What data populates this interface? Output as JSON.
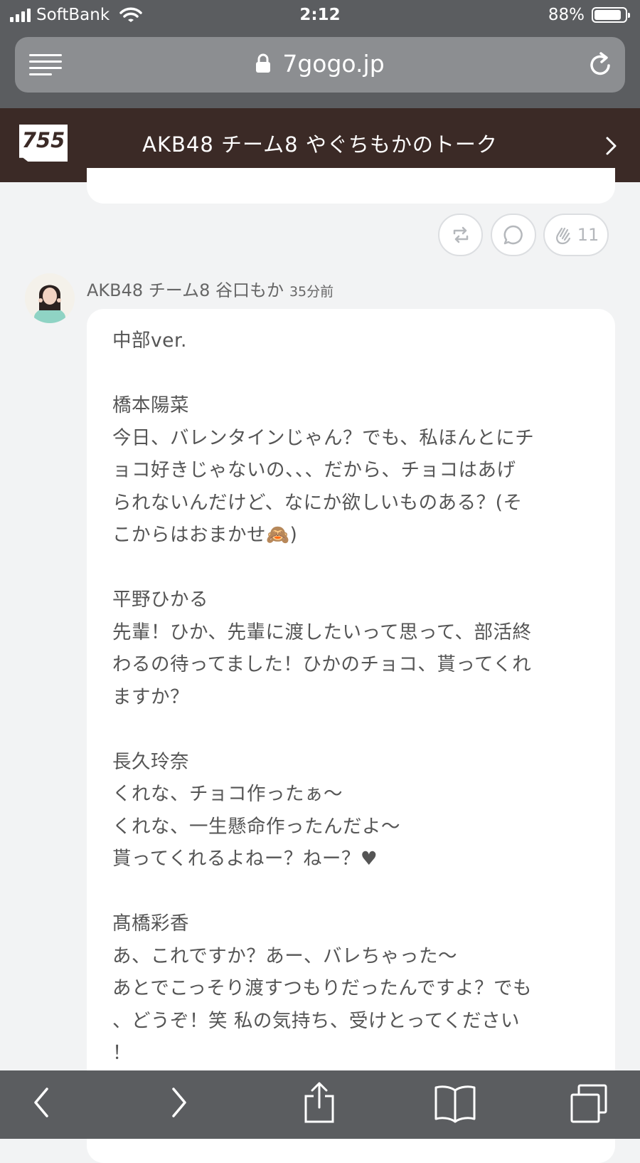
{
  "status_bar": {
    "carrier": "SoftBank",
    "time": "2:12",
    "battery_percent": "88%",
    "battery_level": 0.88
  },
  "browser": {
    "url": "7gogo.jp"
  },
  "header": {
    "logo": "755",
    "title": "AKB48 チーム8 やぐちもかのトーク"
  },
  "actions": {
    "clap_count": "11"
  },
  "post": {
    "author": "AKB48 チーム8 谷口もか",
    "time_ago": "35分前",
    "lines": [
      "中部ver.",
      "",
      "橋本陽菜",
      "今日、バレンタインじゃん？でも、私ほんとにチ",
      "ョコ好きじゃないの、、、だから、チョコはあげ",
      "られないんだけど、なにか欲しいものある？(そ",
      "こからはおまかせ🙈)",
      "",
      "平野ひかる",
      "先輩！ひか、先輩に渡したいって思って、部活終",
      "わるの待ってました！ひかのチョコ、貰ってくれ",
      "ますか？",
      "",
      "長久玲奈",
      "くれな、チョコ作ったぁ〜",
      "くれな、一生懸命作ったんだよ〜",
      "貰ってくれるよねー？ねー？♥",
      "",
      "髙橋彩香",
      "あ、これですか？あー、バレちゃった〜",
      "あとでこっそり渡すつもりだったんですよ？でも",
      "、どうぞ！笑 私の気持ち、受けとってください",
      "！"
    ]
  }
}
